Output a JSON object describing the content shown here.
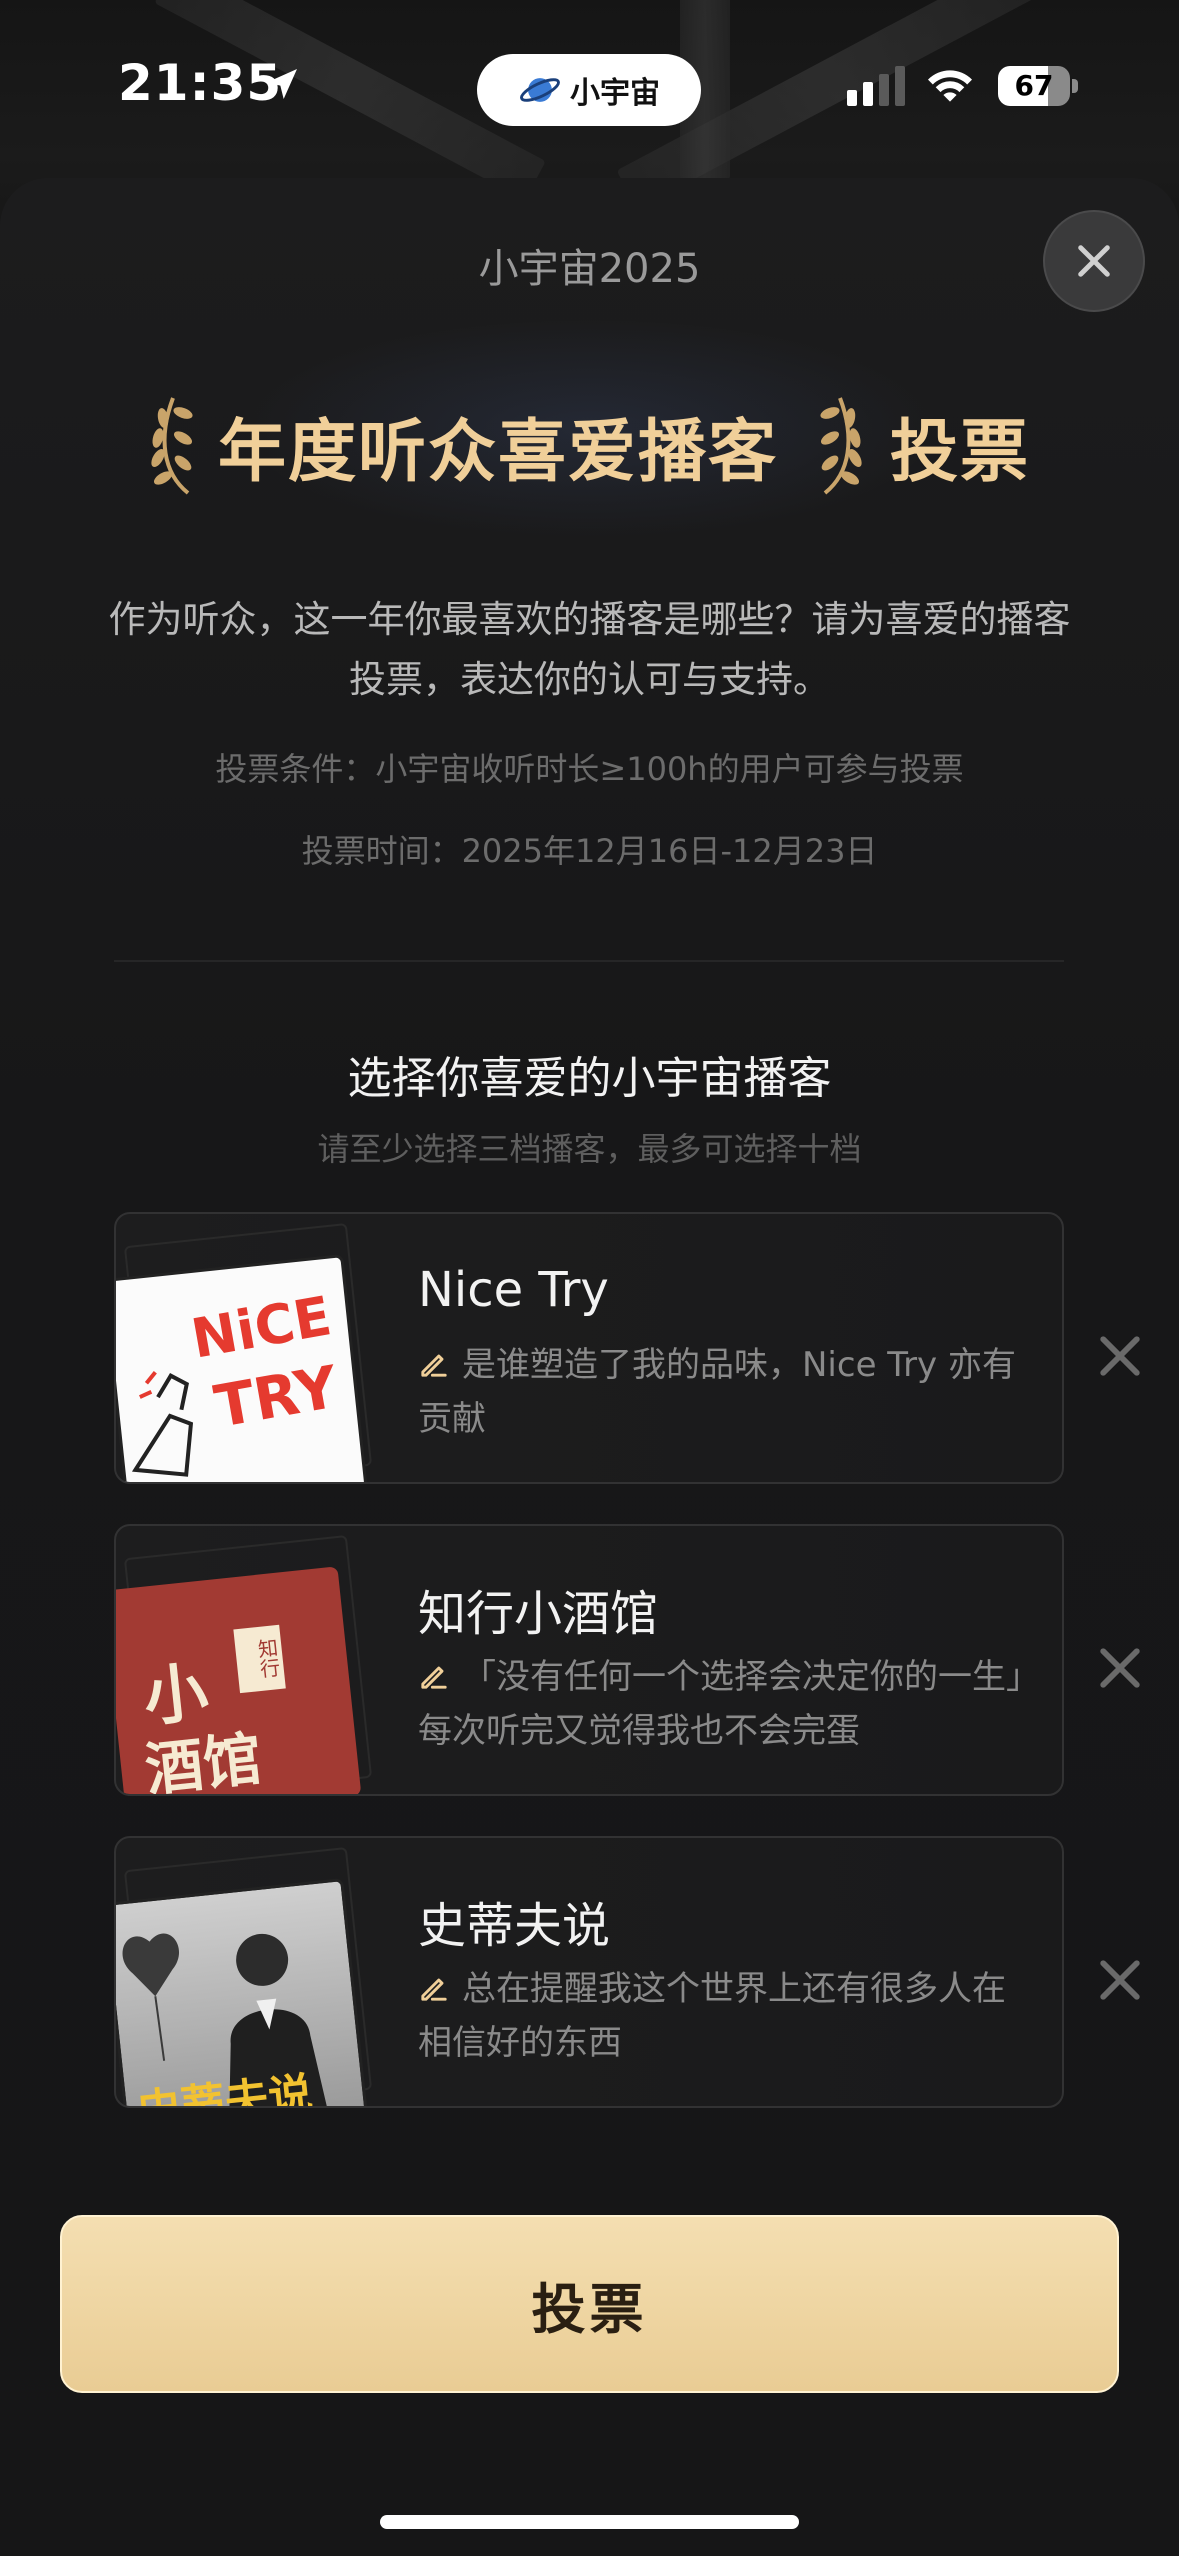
{
  "status_bar": {
    "time": "21:35",
    "app_name": "小宇宙",
    "battery": "67",
    "icons": [
      "location-arrow-icon",
      "signal-icon",
      "wifi-icon",
      "battery-icon"
    ]
  },
  "sheet": {
    "brand_title": "小宇宙2025",
    "award_title": "年度听众喜爱播客",
    "award_suffix": "投票",
    "description": "作为听众，这一年你最喜欢的播客是哪些？请为喜爱的播客投票，表达你的认可与支持。",
    "condition": "投票条件：小宇宙收听时长≥100h的用户可参与投票",
    "vote_time": "投票时间：2025年12月16日-12月23日",
    "select_title": "选择你喜爱的小宇宙播客",
    "select_subtitle": "请至少选择三档播客，最多可选择十档"
  },
  "podcasts": [
    {
      "name": "Nice Try",
      "quote": "是谁塑造了我的品味，Nice Try 亦有贡献",
      "cover_text_1": "NiCE",
      "cover_text_2": "TRY"
    },
    {
      "name": "知行小酒馆",
      "quote": "「没有任何一个选择会决定你的一生」每次听完又觉得我也不会完蛋",
      "cover_text_1": "小",
      "cover_text_2": "酒馆",
      "cover_text_3": "知行"
    },
    {
      "name": "史蒂夫说",
      "quote": "总在提醒我这个世界上还有很多人在相信好的东西",
      "cover_text_1": "史蒂夫说"
    }
  ],
  "vote_button": {
    "label": "投票"
  },
  "colors": {
    "accent_gold": "#f0cf99",
    "button_gold": "#efd6a3",
    "background": "#161617"
  }
}
